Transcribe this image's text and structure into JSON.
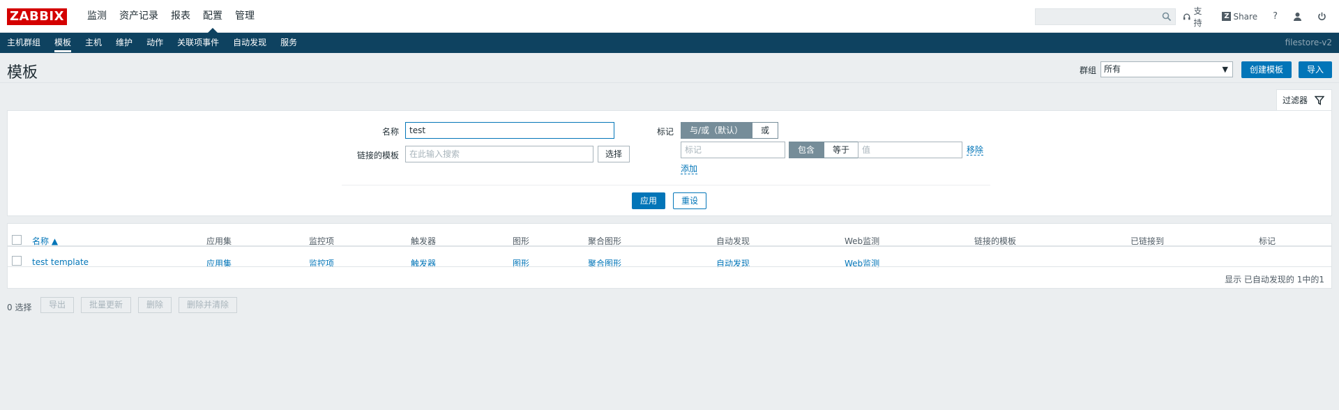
{
  "logo": "ZABBIX",
  "main_menu": [
    "监测",
    "资产记录",
    "报表",
    "配置",
    "管理"
  ],
  "search": {
    "placeholder": ""
  },
  "top_links": {
    "support": "支持",
    "share": "Share",
    "help": "?"
  },
  "sub_menu": [
    "主机群组",
    "模板",
    "主机",
    "维护",
    "动作",
    "关联项事件",
    "自动发现",
    "服务"
  ],
  "server_name": "filestore-v2",
  "page_title": "模板",
  "header": {
    "group_label": "群组",
    "group_value": "所有",
    "create_button": "创建模板",
    "import_button": "导入"
  },
  "filter": {
    "tab_label": "过滤器",
    "name_label": "名称",
    "name_value": "test",
    "linked_label": "链接的模板",
    "linked_placeholder": "在此输入搜索",
    "select_button": "选择",
    "tags_label": "标记",
    "and_or": "与/或（默认）",
    "or": "或",
    "tag_placeholder": "标记",
    "contains": "包含",
    "equals": "等于",
    "value_placeholder": "值",
    "remove": "移除",
    "add": "添加",
    "apply": "应用",
    "reset": "重设"
  },
  "table": {
    "columns": [
      "名称 ▲",
      "应用集",
      "监控项",
      "触发器",
      "图形",
      "聚合图形",
      "自动发现",
      "Web监测",
      "链接的模板",
      "已链接到",
      "标记"
    ],
    "rows": [
      [
        "test template",
        "应用集",
        "监控项",
        "触发器",
        "图形",
        "聚合图形",
        "自动发现",
        "Web监测",
        "",
        "",
        ""
      ]
    ],
    "footer": "显示 已自动发现的 1中的1"
  },
  "bottom": {
    "selected": "0 选择",
    "export": "导出",
    "mass_update": "批量更新",
    "delete": "删除",
    "delete_clear": "删除并清除"
  }
}
